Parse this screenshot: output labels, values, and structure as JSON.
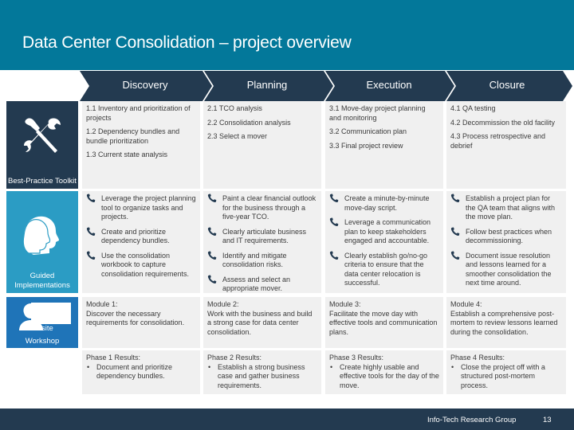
{
  "colors": {
    "header": "#03789a",
    "navy": "#233a50",
    "guided": "#2b9cc4",
    "onsite": "#1f74b8",
    "cell": "#f0f0f0"
  },
  "title": "Data Center Consolidation – project overview",
  "phases": [
    {
      "label": "Discovery"
    },
    {
      "label": "Planning"
    },
    {
      "label": "Execution"
    },
    {
      "label": "Closure"
    }
  ],
  "rows": {
    "toolkit": {
      "label": "Best-Practice Toolkit",
      "icon": "tools-icon",
      "cells": [
        [
          "1.1 Inventory and prioritization of projects",
          "1.2 Dependency bundles and bundle prioritization",
          "1.3 Current state analysis"
        ],
        [
          "2.1 TCO analysis",
          "2.2 Consolidation analysis",
          "2.3 Select a mover"
        ],
        [
          "3.1 Move-day project planning and monitoring",
          "3.2 Communication plan",
          "3.3 Final project review"
        ],
        [
          "4.1 QA testing",
          "4.2 Decommission the old facility",
          "4.3 Process retrospective and debrief"
        ]
      ]
    },
    "guided": {
      "label": "Guided Implementations",
      "icon": "phone-heads-icon",
      "cells": [
        [
          "Leverage the project planning tool to organize tasks and projects.",
          "Create and prioritize dependency bundles.",
          "Use the consolidation workbook to capture consolidation requirements."
        ],
        [
          "Paint a clear financial outlook for the business through a five-year TCO.",
          "Clearly articulate business and IT requirements.",
          "Identify and mitigate consolidation risks.",
          "Assess and select an appropriate mover."
        ],
        [
          "Create a minute-by-minute move-day script.",
          "Leverage a communication plan to keep stakeholders engaged and accountable.",
          "Clearly establish go/no-go criteria to ensure that the data center relocation is successful."
        ],
        [
          "Establish a project plan for the QA team that aligns with the move plan.",
          "Follow best practices when decommissioning.",
          "Document issue resolution and lessons learned for a smoother consolidation the next time around."
        ]
      ]
    },
    "onsite": {
      "label_visible": "site",
      "label_line2": "Workshop",
      "icon": "person-icon",
      "modules": [
        {
          "title": "Module 1:",
          "text": "Discover the necessary requirements for consolidation."
        },
        {
          "title": "Module 2:",
          "text": "Work with the business and build a strong case for data center consolidation."
        },
        {
          "title": "Module 3:",
          "text": "Facilitate the move day with effective tools and communication plans."
        },
        {
          "title": "Module 4:",
          "text": "Establish a comprehensive post-mortem to review lessons learned during the consolidation."
        }
      ]
    },
    "results": [
      {
        "title": "Phase 1 Results:",
        "item": "Document and prioritize dependency bundles."
      },
      {
        "title": "Phase 2 Results:",
        "item": "Establish a strong business case and gather business requirements."
      },
      {
        "title": "Phase 3 Results:",
        "item": "Create highly usable and effective tools for the day of the move."
      },
      {
        "title": "Phase 4 Results:",
        "item": "Close the project off with a structured post-mortem process."
      }
    ]
  },
  "bullet_glyph": "•",
  "footer": {
    "org": "Info-Tech Research Group",
    "page": "13"
  }
}
